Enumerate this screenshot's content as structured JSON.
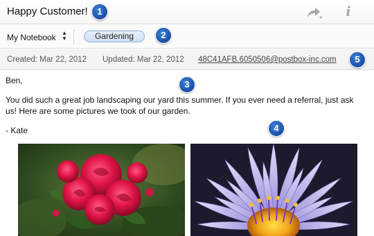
{
  "note": {
    "title": "Happy Customer!",
    "notebook": "My Notebook",
    "tag": "Gardening",
    "created": "Created: Mar 22, 2012",
    "updated": "Updated: Mar 22, 2012",
    "source_link": "48C41AFB.6050506@postbox-inc.com",
    "body": {
      "greeting": "Ben,",
      "message": "You did such a great job landscaping our yard this summer. If you ever need a referral, just ask us!  Here are some pictures we took of our garden.",
      "signature": "- Kate"
    },
    "images": [
      "red-roses-photo",
      "purple-water-lily-photo"
    ]
  },
  "toolbar": {
    "icons": [
      "forward-icon",
      "info-icon"
    ],
    "info_glyph": "i",
    "select_up_glyph": "▲",
    "select_down_glyph": "▼"
  },
  "callouts": [
    "1",
    "2",
    "3",
    "4",
    "5"
  ],
  "colors": {
    "badge": "#1f5fbf",
    "tag_border": "#8eb0d6",
    "tag_fill": "#d9e6f5",
    "divider": "#dcdcdc"
  }
}
